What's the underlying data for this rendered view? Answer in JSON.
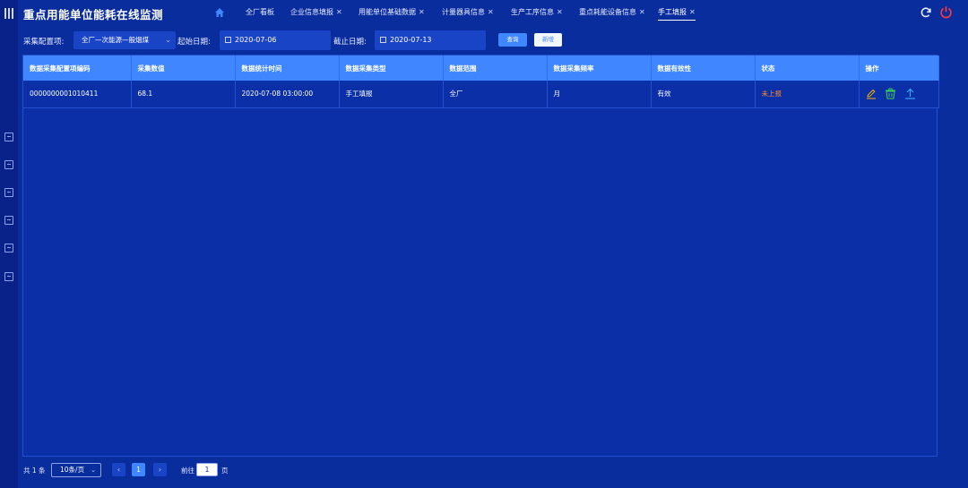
{
  "header": {
    "title": "重点用能单位能耗在线监测",
    "tabs": [
      {
        "label": "全厂看板",
        "closable": false,
        "active": false
      },
      {
        "label": "企业信息填报",
        "closable": true,
        "active": false
      },
      {
        "label": "用能单位基础数据",
        "closable": true,
        "active": false
      },
      {
        "label": "计量器具信息",
        "closable": true,
        "active": false
      },
      {
        "label": "生产工序信息",
        "closable": true,
        "active": false
      },
      {
        "label": "重点耗能设备信息",
        "closable": true,
        "active": false
      },
      {
        "label": "手工填报",
        "closable": true,
        "active": true
      }
    ],
    "close_glyph": "✕",
    "icons": [
      "home-icon",
      "refresh-icon",
      "power-icon"
    ]
  },
  "sidebar": {
    "toggle_icon": "menu-icon",
    "icons": [
      "list-icon",
      "chart-icon",
      "document-icon",
      "report-icon",
      "calendar-icon",
      "edit-icon"
    ]
  },
  "filters": {
    "config_label": "采集配置项:",
    "config_value": "全厂—次能源—般烟煤",
    "start_label": "起始日期:",
    "start_value": "2020-07-06",
    "end_label": "截止日期:",
    "end_value": "2020-07-13",
    "query_label": "查询",
    "add_label": "新增"
  },
  "table": {
    "columns": [
      "数据采集配置项编码",
      "采集数值",
      "数据统计时间",
      "数据采集类型",
      "数据范围",
      "数据采集频率",
      "数据有效性",
      "状态",
      "操作"
    ],
    "rows": [
      {
        "code": "0000000001010411",
        "value": "68.1",
        "time": "2020-07-08 03:00:00",
        "type": "手工填报",
        "scope": "全厂",
        "frequency": "月",
        "validity": "有效",
        "status": "未上报",
        "actions": [
          "edit-icon",
          "delete-icon",
          "upload-icon"
        ]
      }
    ]
  },
  "pagination": {
    "total": "共 1 条",
    "page_size": "10条/页",
    "prev": "‹",
    "current_page": "1",
    "next": "›",
    "goto_label": "前往",
    "goto_value": "1",
    "page_unit": "页"
  },
  "colors": {
    "background": "#0a2d9e",
    "header_row": "#3f86ff",
    "status_pending": "#ff8a2b",
    "power": "#ff3b3b",
    "delete": "#39d353",
    "edit": "#f0b400",
    "upload": "#3fa9ff"
  }
}
